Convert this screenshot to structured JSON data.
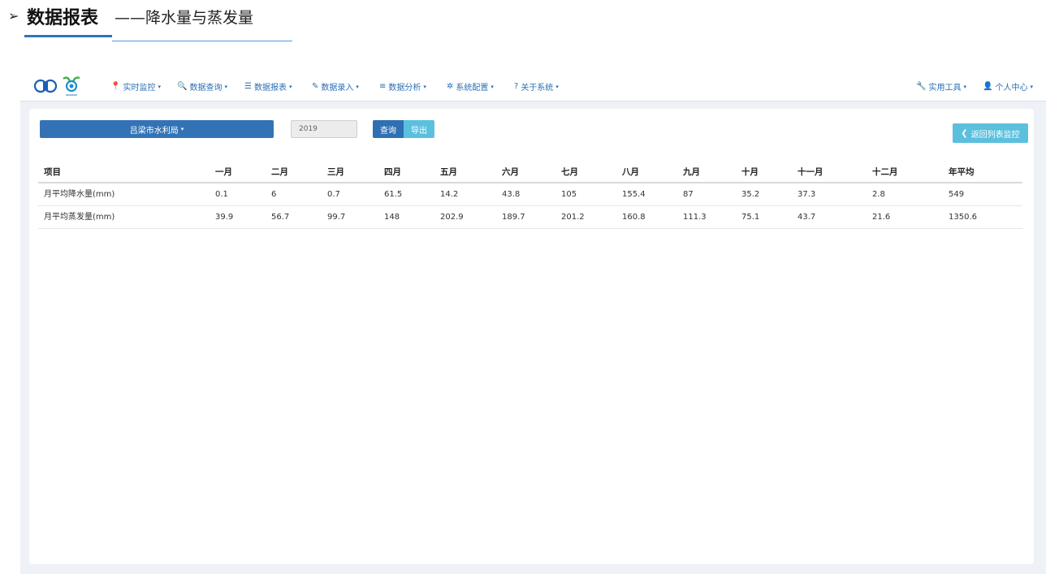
{
  "heading": {
    "arrow": "➢",
    "strong": "数据报表",
    "rest": "——降水量与蒸发量"
  },
  "navbar": {
    "items": [
      {
        "icon": "📍",
        "label": "实时监控"
      },
      {
        "icon": "🔍",
        "label": "数据查询"
      },
      {
        "icon": "☰",
        "label": "数据报表"
      },
      {
        "icon": "✎",
        "label": "数据录入"
      },
      {
        "icon": "≡",
        "label": "数据分析"
      },
      {
        "icon": "✲",
        "label": "系统配置"
      },
      {
        "icon": "?",
        "label": "关于系统"
      }
    ],
    "right": [
      {
        "icon": "🔧",
        "label": "实用工具"
      },
      {
        "icon": "👤",
        "label": "个人中心"
      }
    ],
    "caret": "▾"
  },
  "toolbar": {
    "department": "吕梁市水利局",
    "year": "2019",
    "query": "查询",
    "export": "导出",
    "back": "返回列表监控",
    "back_icon": "❮"
  },
  "table": {
    "headers": [
      "项目",
      "一月",
      "二月",
      "三月",
      "四月",
      "五月",
      "六月",
      "七月",
      "八月",
      "九月",
      "十月",
      "十一月",
      "十二月",
      "年平均"
    ],
    "rows": [
      [
        "月平均降水量(mm)",
        "0.1",
        "6",
        "0.7",
        "61.5",
        "14.2",
        "43.8",
        "105",
        "155.4",
        "87",
        "35.2",
        "37.3",
        "2.8",
        "549"
      ],
      [
        "月平均蒸发量(mm)",
        "39.9",
        "56.7",
        "99.7",
        "148",
        "202.9",
        "189.7",
        "201.2",
        "160.8",
        "111.3",
        "75.1",
        "43.7",
        "21.6",
        "1350.6"
      ]
    ]
  },
  "colors": {
    "primary": "#3373b5",
    "info": "#5bc0de",
    "nav_text": "#2a6fb5"
  }
}
